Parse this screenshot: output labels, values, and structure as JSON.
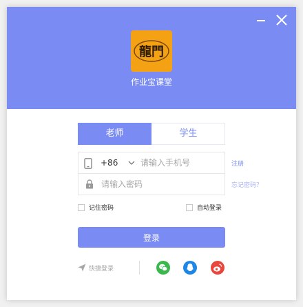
{
  "header": {
    "app_name": "作业宝课堂",
    "logo_text": "龍門",
    "brand_color": "#7a8cf4",
    "logo_bg_color": "#f5a114"
  },
  "window_controls": {
    "minimize_icon": "minimize-icon",
    "close_icon": "close-icon"
  },
  "tabs": [
    {
      "label": "老师",
      "active": true
    },
    {
      "label": "学生",
      "active": false
    }
  ],
  "phone_field": {
    "icon": "mobile-phone-icon",
    "country_code": "+86",
    "placeholder": "请输入手机号",
    "value": ""
  },
  "password_field": {
    "icon": "lock-icon",
    "placeholder": "请输入密码",
    "value": ""
  },
  "links": {
    "register": "注册",
    "forgot_password": "忘记密码？"
  },
  "options": {
    "remember_password": "记住密码",
    "auto_login": "自动登录"
  },
  "login_button": "登录",
  "quick_login": {
    "label": "快捷登录",
    "icon": "send-icon"
  },
  "social": [
    {
      "name": "wechat",
      "icon": "wechat-icon",
      "color": "#3bb84b"
    },
    {
      "name": "qq",
      "icon": "qq-icon",
      "color": "#1e87e6"
    },
    {
      "name": "weibo",
      "icon": "weibo-icon",
      "color": "#e8483b"
    }
  ]
}
